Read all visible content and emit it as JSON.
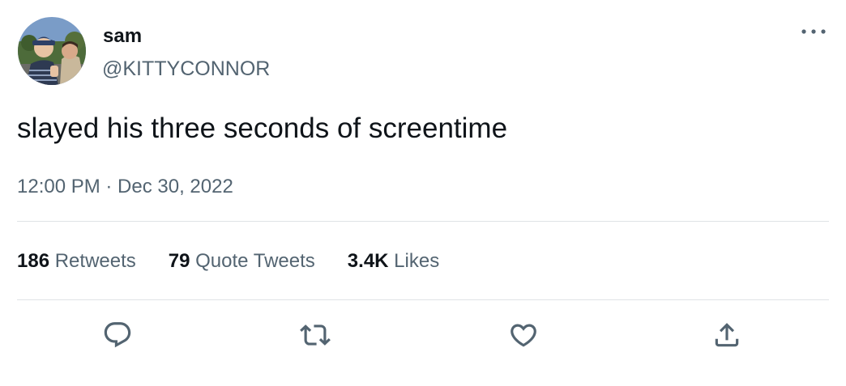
{
  "author": {
    "display_name": "sam",
    "handle": "@KITTYCONNOR",
    "avatar_icon": "profile-photo"
  },
  "tweet": {
    "text": "slayed his three seconds of screentime",
    "timestamp": "12:00 PM · Dec 30, 2022"
  },
  "stats": {
    "retweets_count": "186",
    "retweets_label": "Retweets",
    "quotes_count": "79",
    "quotes_label": "Quote Tweets",
    "likes_count": "3.4K",
    "likes_label": "Likes"
  },
  "actions": {
    "reply_icon": "speech-bubble-icon",
    "retweet_icon": "retweet-arrows-icon",
    "like_icon": "heart-icon",
    "share_icon": "share-upload-icon",
    "more_icon": "ellipsis-icon"
  },
  "colors": {
    "text_primary": "#0f1419",
    "text_secondary": "#536471",
    "divider": "#dfe3e6",
    "background": "#ffffff"
  }
}
